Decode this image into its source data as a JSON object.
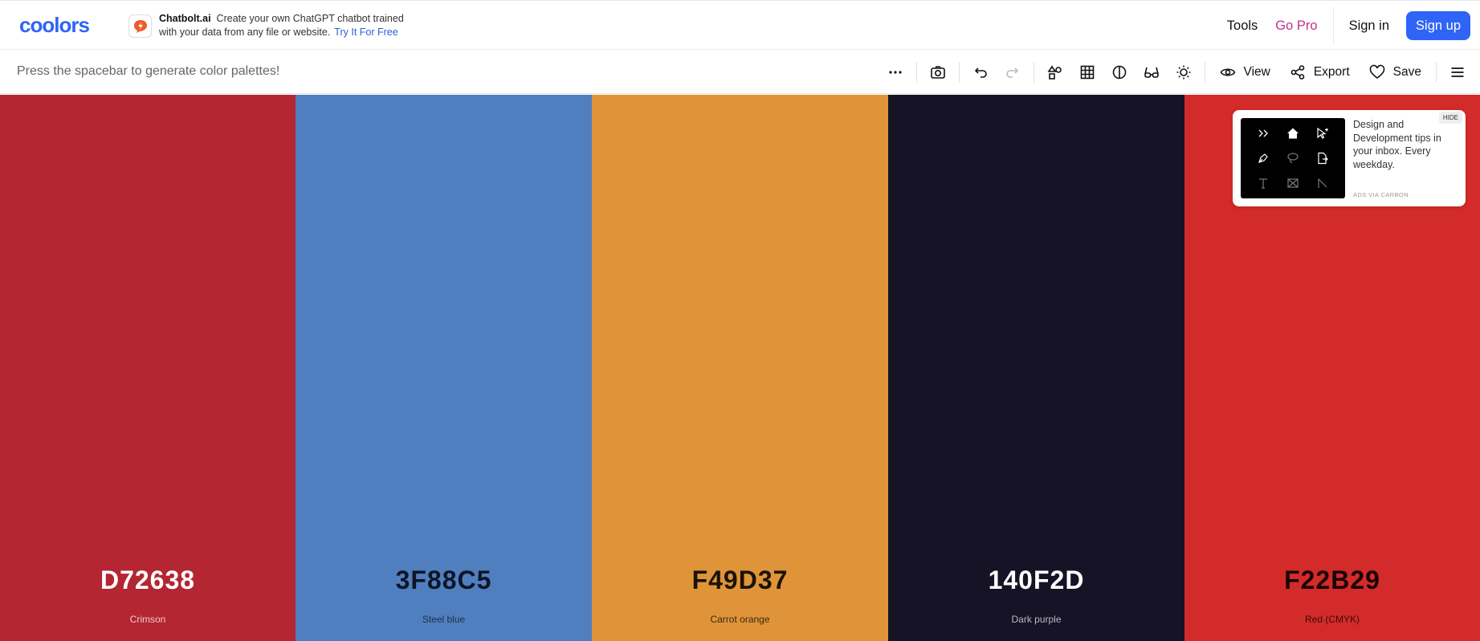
{
  "header": {
    "logo": "coolors",
    "ad": {
      "brand": "Chatbolt.ai",
      "line1": "Create your own ChatGPT chatbot trained",
      "line2": "with your data from any file or website.",
      "cta": "Try It For Free"
    },
    "nav": {
      "tools": "Tools",
      "go_pro": "Go Pro",
      "sign_in": "Sign in",
      "sign_up": "Sign up"
    }
  },
  "toolbar": {
    "hint": "Press the spacebar to generate color palettes!",
    "icons": [
      "more-icon",
      "camera-icon",
      "undo-icon",
      "redo-icon",
      "shapes-icon",
      "grid-icon",
      "contrast-icon",
      "glasses-icon",
      "brightness-icon",
      "menu-icon"
    ],
    "view_label": "View",
    "export_label": "Export",
    "save_label": "Save"
  },
  "palette": [
    {
      "hex": "D72638",
      "name": "Crimson",
      "color": "#B32632",
      "text_color": "#FFFFFF",
      "name_color": "#F2C8CC"
    },
    {
      "hex": "3F88C5",
      "name": "Steel blue",
      "color": "#4F7FBE",
      "text_color": "#0E1525",
      "name_color": "#22304A"
    },
    {
      "hex": "F49D37",
      "name": "Carrot orange",
      "color": "#DF9439",
      "text_color": "#1A1206",
      "name_color": "#3A2A12"
    },
    {
      "hex": "140F2D",
      "name": "Dark purple",
      "color": "#151325",
      "text_color": "#FFFFFF",
      "name_color": "#B9B7C8"
    },
    {
      "hex": "F22B29",
      "name": "Red (CMYK)",
      "color": "#D22B29",
      "text_color": "#1A0505",
      "name_color": "#3A0C0C"
    }
  ],
  "carbon_ad": {
    "text": "Design and Development tips in your inbox. Every weekday.",
    "via": "ADS VIA CARBON",
    "hide": "HIDE"
  }
}
